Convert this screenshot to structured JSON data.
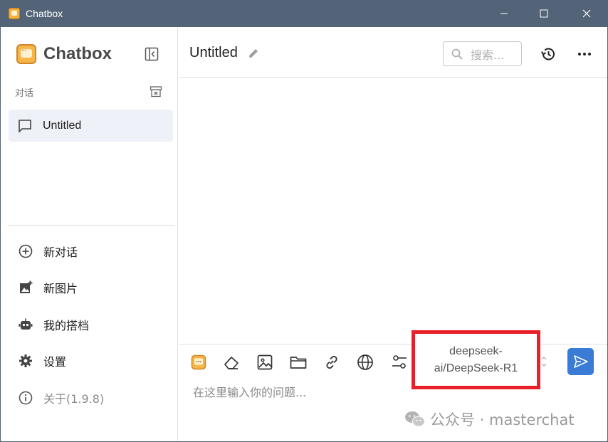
{
  "window": {
    "title": "Chatbox",
    "controls": {
      "minimize": "minimize-icon",
      "maximize": "maximize-icon",
      "close": "close-icon"
    }
  },
  "sidebar": {
    "brand": "Chatbox",
    "section_label": "对话",
    "conversations": [
      {
        "label": "Untitled"
      }
    ],
    "menu": {
      "new_chat": "新对话",
      "new_image": "新图片",
      "partners": "我的搭档",
      "settings": "设置",
      "about": "关于(1.9.8)"
    }
  },
  "header": {
    "title": "Untitled",
    "search_placeholder": "搜索..."
  },
  "composer": {
    "model": "deepseek-ai/DeepSeek-R1",
    "input_placeholder": "在这里输入你的问题..."
  },
  "watermark": "公众号 · masterchat",
  "colors": {
    "titlebar": "#546478",
    "accent": "#3a7bd5",
    "highlight": "#e8202a",
    "selected": "#eef1f7"
  }
}
